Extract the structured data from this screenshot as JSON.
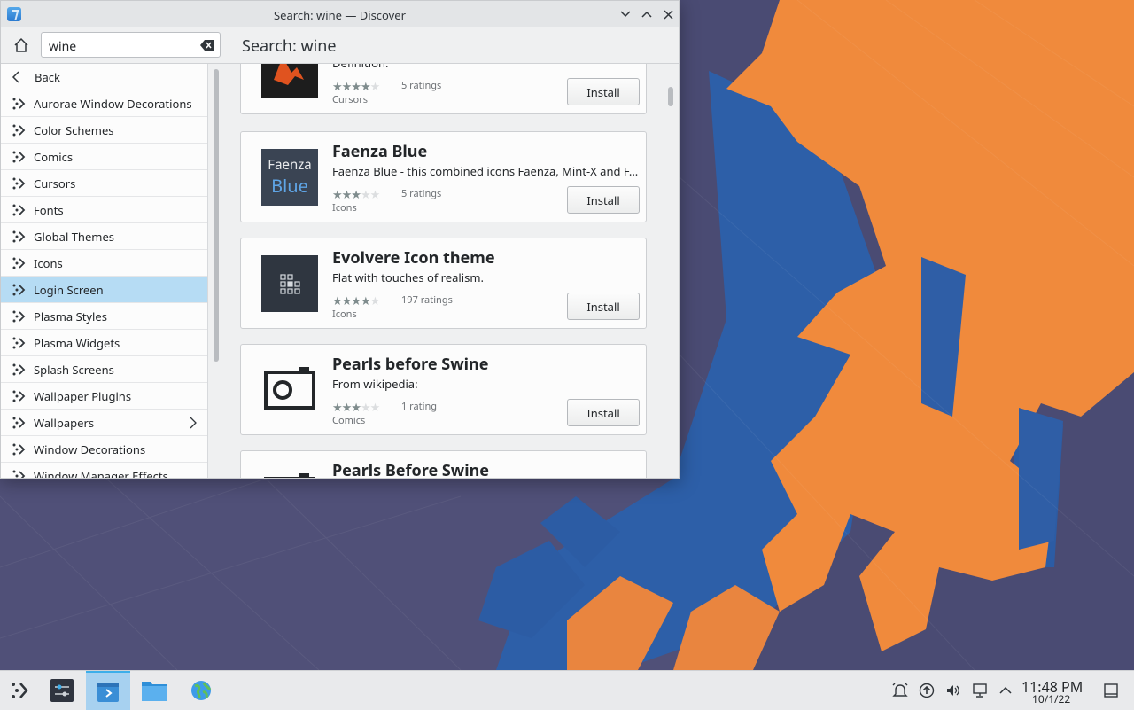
{
  "window": {
    "title": "Search: wine — Discover",
    "minimize_glyph": "﹀",
    "maximize_glyph": "︿",
    "close_glyph": "✕"
  },
  "toolbar": {
    "search_value": "wine",
    "page_heading": "Search: wine"
  },
  "sidebar": {
    "back_label": "Back",
    "items": [
      {
        "label": "Aurorae Window Decorations"
      },
      {
        "label": "Color Schemes"
      },
      {
        "label": "Comics"
      },
      {
        "label": "Cursors"
      },
      {
        "label": "Fonts"
      },
      {
        "label": "Global Themes"
      },
      {
        "label": "Icons"
      },
      {
        "label": "Login Screen",
        "selected": true
      },
      {
        "label": "Plasma Styles"
      },
      {
        "label": "Plasma Widgets"
      },
      {
        "label": "Splash Screens"
      },
      {
        "label": "Wallpaper Plugins"
      },
      {
        "label": "Wallpapers",
        "has_submenu": true
      },
      {
        "label": "Window Decorations"
      },
      {
        "label": "Window Manager Effects"
      }
    ]
  },
  "results": [
    {
      "name": "",
      "description": "Definition:",
      "stars": 4,
      "ratings": "5 ratings",
      "category": "Cursors",
      "install_label": "Install",
      "thumb": "cursor-thumb"
    },
    {
      "name": "Faenza Blue",
      "description": "Faenza Blue - this combined icons Faenza, Mint-X and F...",
      "stars": 3,
      "ratings": "5 ratings",
      "category": "Icons",
      "install_label": "Install",
      "thumb": "faenza-thumb",
      "thumb_text_1": "Faenza",
      "thumb_text_2": "Blue"
    },
    {
      "name": "Evolvere Icon theme",
      "description": "Flat with touches of realism.",
      "stars": 4,
      "ratings": "197 ratings",
      "category": "Icons",
      "install_label": "Install",
      "thumb": "evolvere-thumb"
    },
    {
      "name": "Pearls before Swine",
      "description": "From wikipedia:",
      "stars": 3,
      "ratings": "1 rating",
      "category": "Comics",
      "install_label": "Install",
      "thumb": "camera-icon"
    },
    {
      "name": "Pearls Before Swine",
      "description": "",
      "stars": 0,
      "ratings": "",
      "category": "",
      "install_label": "",
      "thumb": "camera-icon"
    }
  ],
  "taskbar": {
    "apps": [
      "app-launcher-icon",
      "system-settings-icon",
      "discover-icon",
      "file-manager-icon",
      "web-browser-icon"
    ],
    "active_app": "discover-icon",
    "tray": [
      "notifications-icon",
      "updates-icon",
      "volume-icon",
      "network-icon",
      "expand-tray-icon"
    ],
    "time": "11:48 PM",
    "date": "10/1/22"
  },
  "colors": {
    "accent": "#3daee9",
    "selection": "#b6dcf4",
    "wallpaper_orange": "#f08a3c",
    "wallpaper_blue": "#2d5fa8"
  }
}
